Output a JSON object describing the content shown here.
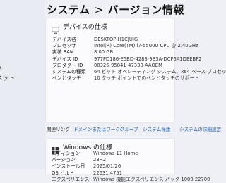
{
  "header": {
    "system": "システム",
    "separator": ">",
    "page_title": "バージョン情報"
  },
  "sidebar": {
    "items": [
      {
        "label": "ム"
      },
      {
        "label": "ネット"
      }
    ]
  },
  "device_spec": {
    "title": "デバイスの仕様",
    "rows": [
      {
        "key": "デバイス名",
        "value": "DESKTOP-H1CJUIG"
      },
      {
        "key": "プロセッサ",
        "value": "Intel(R) Core(TM) i7-5500U CPU @ 2.40GHz"
      },
      {
        "key": "実装 RAM",
        "value": "8.00 GB"
      },
      {
        "key": "デバイス ID",
        "value": "977FD186-E5BD-4283-9B3A-DCF6A1DEEBF2"
      },
      {
        "key": "プロダクト ID",
        "value": "00325-95841-47338-AAOEM"
      },
      {
        "key": "システムの種類",
        "value": "64 ビット オペレーティング システム、x64 ベース プロセッサ"
      },
      {
        "key": "ペンとタッチ",
        "value": "10 タッチ ポイントでのペンとタッチのサポート"
      }
    ]
  },
  "related_links": {
    "label": "関連リンク",
    "items": [
      "ドメインまたはワークグループ",
      "システム保護",
      "システムの詳細設定"
    ]
  },
  "windows_spec": {
    "title": "Windows の仕様",
    "rows": [
      {
        "key": "エディション",
        "value": "Windows 11 Home"
      },
      {
        "key": "バージョン",
        "value": "23H2"
      },
      {
        "key": "インストール日",
        "value": "2025/01/26"
      },
      {
        "key": "OS ビルド",
        "value": "22631.4751"
      },
      {
        "key": "エクスペリエンス",
        "value": "Windows 機能エクスペリエンス パック 1000.22700"
      }
    ]
  },
  "colors": {
    "page_bg": "#eef0f6",
    "card_bg": "#fbfbfd",
    "link": "#1a5fb4",
    "icon": "#333333"
  }
}
